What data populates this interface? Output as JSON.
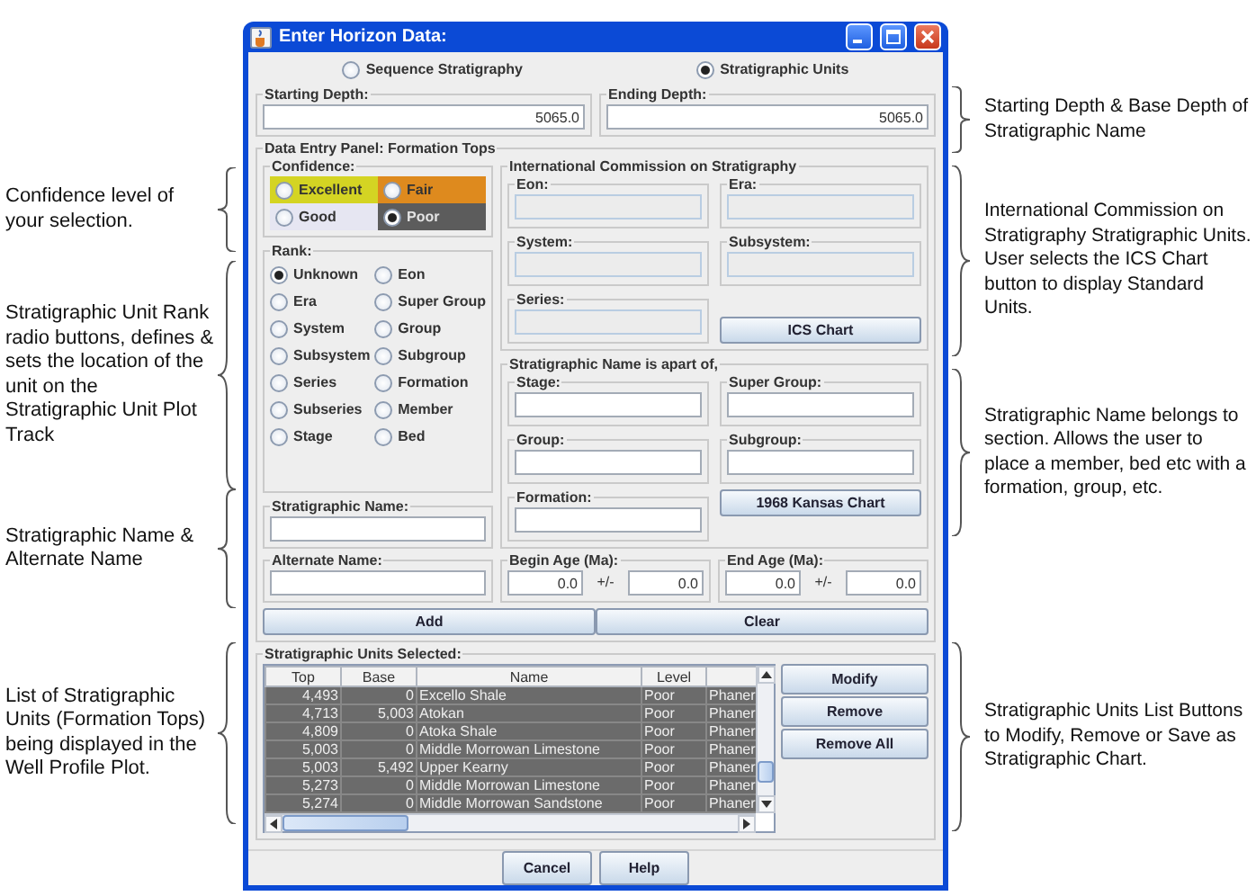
{
  "window": {
    "title": "Enter Horizon Data:"
  },
  "mode_options": [
    {
      "label": "Sequence Stratigraphy",
      "selected": false
    },
    {
      "label": "Stratigraphic Units",
      "selected": true
    }
  ],
  "depth": [
    {
      "label": "Starting Depth:",
      "value": "5065.0"
    },
    {
      "label": "Ending Depth:",
      "value": "5065.0"
    }
  ],
  "panel_title": "Data Entry Panel: Formation Tops",
  "confidence": {
    "label": "Confidence:",
    "options": [
      {
        "label": "Excellent",
        "selected": false,
        "color": "#d4d423"
      },
      {
        "label": "Fair",
        "selected": false,
        "color": "#de8a1e"
      },
      {
        "label": "Good",
        "selected": false,
        "color": "#e6e6f2"
      },
      {
        "label": "Poor",
        "selected": true,
        "color": "#5c5c5c"
      }
    ]
  },
  "rank": {
    "label": "Rank:",
    "options": [
      {
        "label": "Unknown",
        "selected": true
      },
      {
        "label": "Eon",
        "selected": false
      },
      {
        "label": "Era",
        "selected": false
      },
      {
        "label": "Super Group",
        "selected": false
      },
      {
        "label": "System",
        "selected": false
      },
      {
        "label": "Group",
        "selected": false
      },
      {
        "label": "Subsystem",
        "selected": false
      },
      {
        "label": "Subgroup",
        "selected": false
      },
      {
        "label": "Series",
        "selected": false
      },
      {
        "label": "Formation",
        "selected": false
      },
      {
        "label": "Subseries",
        "selected": false
      },
      {
        "label": "Member",
        "selected": false
      },
      {
        "label": "Stage",
        "selected": false
      },
      {
        "label": "Bed",
        "selected": false
      }
    ]
  },
  "stratigraphic_name": {
    "label": "Stratigraphic Name:"
  },
  "ics": {
    "title": "International Commission on Stratigraphy",
    "fields": [
      {
        "label": "Eon:",
        "disabled": true
      },
      {
        "label": "Era:",
        "disabled": true
      },
      {
        "label": "System:",
        "disabled": true
      },
      {
        "label": "Subsystem:",
        "disabled": true
      },
      {
        "label": "Series:",
        "disabled": true
      }
    ],
    "button": "ICS Chart"
  },
  "part_of": {
    "title": "Stratigraphic Name is apart of,",
    "fields": [
      {
        "label": "Stage:",
        "disabled": false
      },
      {
        "label": "Super Group:",
        "disabled": false
      },
      {
        "label": "Group:",
        "disabled": false
      },
      {
        "label": "Subgroup:",
        "disabled": false
      },
      {
        "label": "Formation:",
        "disabled": false
      }
    ],
    "button": "1968 Kansas Chart"
  },
  "alternate_name": {
    "label": "Alternate Name:"
  },
  "ages": [
    {
      "label": "Begin Age (Ma):",
      "value": "0.0",
      "separator": "+/-",
      "error": "0.0"
    },
    {
      "label": "End Age (Ma):",
      "value": "0.0",
      "separator": "+/-",
      "error": "0.0"
    }
  ],
  "entry_buttons": [
    "Add",
    "Clear"
  ],
  "units_selected": {
    "title": "Stratigraphic Units Selected:",
    "columns": [
      "Top",
      "Base",
      "Name",
      "Level"
    ],
    "rows": [
      [
        "4,493",
        "0",
        "Excello Shale",
        "Poor",
        "Phaner"
      ],
      [
        "4,713",
        "5,003",
        "Atokan",
        "Poor",
        "Phaner"
      ],
      [
        "4,809",
        "0",
        "Atoka Shale",
        "Poor",
        "Phaner"
      ],
      [
        "5,003",
        "0",
        "Middle Morrowan Limestone",
        "Poor",
        "Phaner"
      ],
      [
        "5,003",
        "5,492",
        "Upper Kearny",
        "Poor",
        "Phaner"
      ],
      [
        "5,273",
        "0",
        "Middle Morrowan Limestone",
        "Poor",
        "Phaner"
      ],
      [
        "5,274",
        "0",
        "Middle Morrowan Sandstone",
        "Poor",
        "Phaner"
      ]
    ],
    "buttons": [
      "Modify",
      "Remove",
      "Remove All"
    ]
  },
  "footer_buttons": [
    "Cancel",
    "Help"
  ],
  "annotations_left": [
    "Confidence level of your selection.",
    "Stratigraphic Unit Rank radio buttons, defines & sets the location of the unit on the Stratigraphic Unit Plot Track",
    "Stratigraphic Name & Alternate Name",
    "List of Stratigraphic Units (Formation Tops) being displayed in the Well Profile Plot."
  ],
  "annotations_right": [
    "Starting Depth & Base Depth of Stratigraphic Name",
    "International Commission on Stratigraphy Stratigraphic Units. User selects the ICS Chart button to display Standard Units.",
    "Stratigraphic Name belongs to section. Allows the user to place a member, bed etc with a formation, group, etc.",
    "Stratigraphic Units List Buttons to Modify, Remove or Save as Stratigraphic Chart."
  ]
}
